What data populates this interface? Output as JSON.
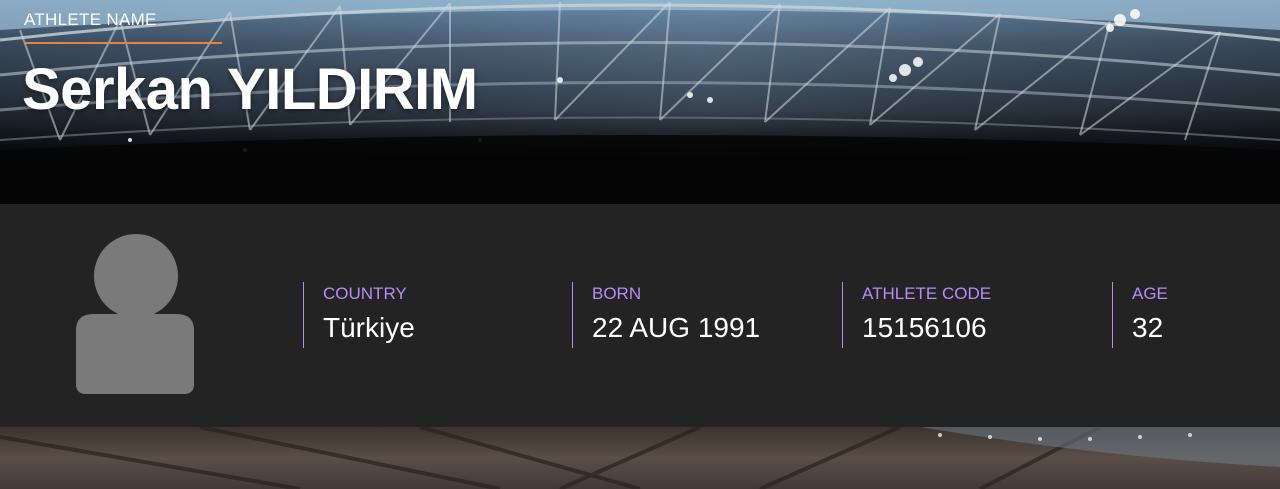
{
  "header": {
    "label": "ATHLETE NAME",
    "name": "Serkan YILDIRIM"
  },
  "info": {
    "fields": [
      {
        "label": "COUNTRY",
        "value": "Türkiye"
      },
      {
        "label": "BORN",
        "value": "22 AUG 1991"
      },
      {
        "label": "ATHLETE CODE",
        "value": "15156106"
      },
      {
        "label": "AGE",
        "value": "32"
      }
    ]
  },
  "colors": {
    "accent_rule": "#e8833a",
    "field_label": "#b78cf7",
    "panel_bg": "#232323",
    "avatar": "#7a7a7a"
  },
  "icons": {
    "avatar": "user-silhouette-icon"
  }
}
